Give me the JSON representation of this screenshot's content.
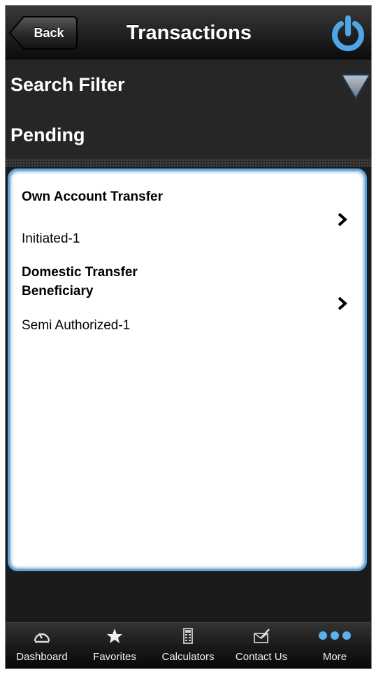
{
  "header": {
    "back_label": "Back",
    "title": "Transactions",
    "power_icon": "power-icon"
  },
  "filter": {
    "label": "Search Filter",
    "toggle_icon": "triangle-down-icon"
  },
  "section": {
    "label": "Pending"
  },
  "items": [
    {
      "title": "Own Account Transfer",
      "status": "Initiated-1"
    },
    {
      "title": "Domestic Transfer Beneficiary",
      "status": "Semi Authorized-1"
    }
  ],
  "tabs": [
    {
      "label": "Dashboard",
      "icon": "speedometer-icon"
    },
    {
      "label": "Favorites",
      "icon": "star-icon"
    },
    {
      "label": "Calculators",
      "icon": "calculator-icon"
    },
    {
      "label": "Contact Us",
      "icon": "envelope-pen-icon"
    },
    {
      "label": "More",
      "icon": "more-dots-icon"
    }
  ],
  "colors": {
    "accent_blue": "#5aa5df",
    "header_bg": "#0c0c0c",
    "section_bg": "#262626"
  }
}
